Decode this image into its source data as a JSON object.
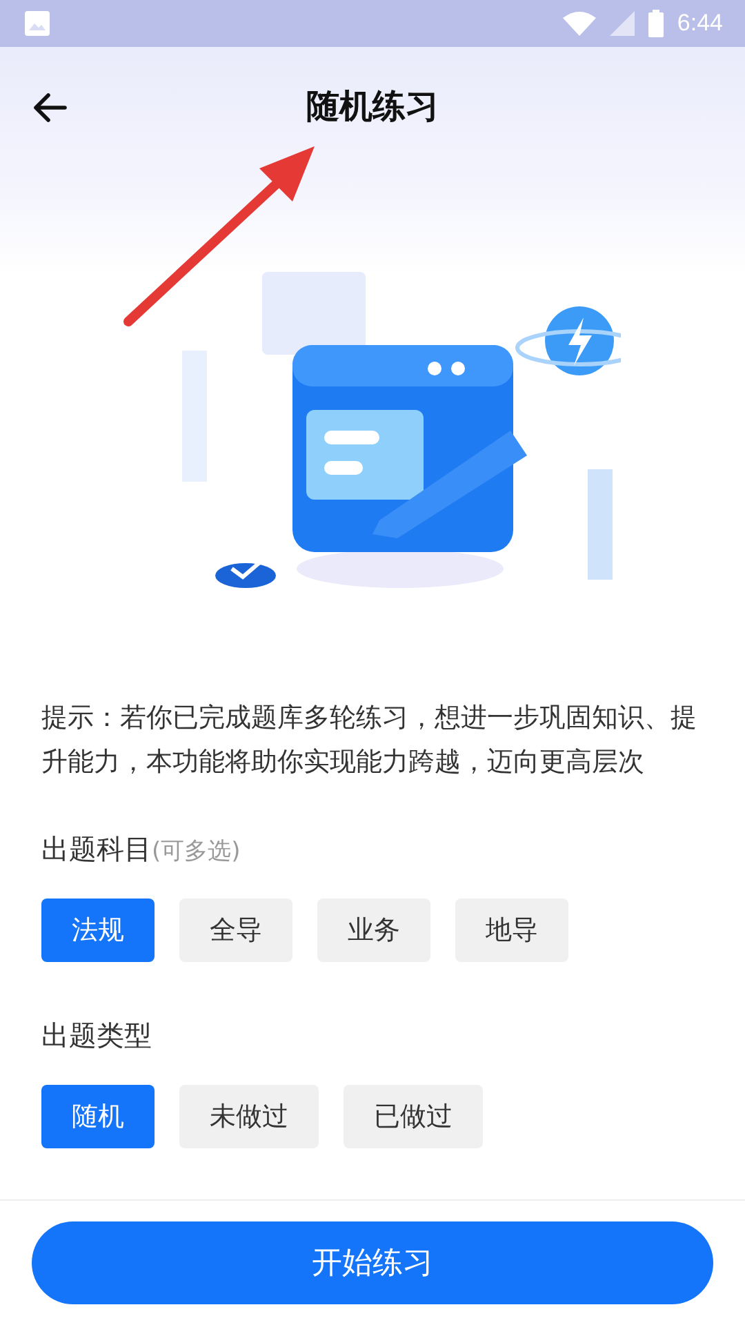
{
  "status_bar": {
    "time": "6:44"
  },
  "header": {
    "title": "随机练习"
  },
  "hint": "提示：若你已完成题库多轮练习，想进一步巩固知识、提升能力，本功能将助你实现能力跨越，迈向更高层次",
  "sections": [
    {
      "label": "出题科目",
      "note": "(可多选)",
      "options": [
        {
          "label": "法规",
          "selected": true
        },
        {
          "label": "全导",
          "selected": false
        },
        {
          "label": "业务",
          "selected": false
        },
        {
          "label": "地导",
          "selected": false
        }
      ]
    },
    {
      "label": "出题类型",
      "options": [
        {
          "label": "随机",
          "selected": true
        },
        {
          "label": "未做过",
          "selected": false
        },
        {
          "label": "已做过",
          "selected": false
        }
      ]
    }
  ],
  "start_button": "开始练习"
}
